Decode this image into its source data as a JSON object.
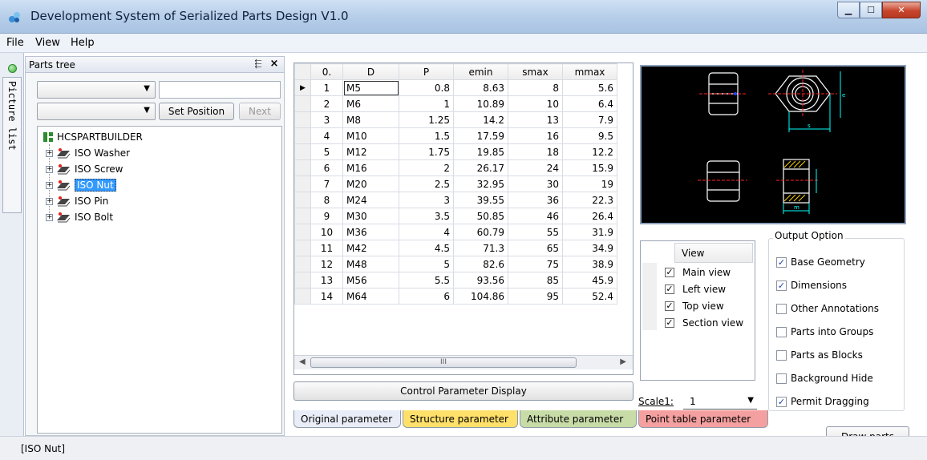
{
  "window": {
    "title": "Development System of Serialized Parts Design V1.0"
  },
  "menu": [
    "File",
    "View",
    "Help"
  ],
  "left_tab": {
    "label": "Picture list"
  },
  "tree_panel": {
    "title": "Parts tree",
    "pin_glyph": "⬱",
    "set_position_label": "Set Position",
    "next_label": "Next",
    "root_label": "HCSPARTBUILDER",
    "items": [
      "ISO Washer",
      "ISO Screw",
      "ISO Nut",
      "ISO Pin",
      "ISO Bolt"
    ],
    "selected_index": 2
  },
  "grid": {
    "columns": [
      "0.",
      "D",
      "P",
      "emin",
      "smax",
      "mmax"
    ],
    "rows": [
      [
        "1",
        "M5",
        "0.8",
        "8.63",
        "8",
        "5.6"
      ],
      [
        "2",
        "M6",
        "1",
        "10.89",
        "10",
        "6.4"
      ],
      [
        "3",
        "M8",
        "1.25",
        "14.2",
        "13",
        "7.9"
      ],
      [
        "4",
        "M10",
        "1.5",
        "17.59",
        "16",
        "9.5"
      ],
      [
        "5",
        "M12",
        "1.75",
        "19.85",
        "18",
        "12.2"
      ],
      [
        "6",
        "M16",
        "2",
        "26.17",
        "24",
        "15.9"
      ],
      [
        "7",
        "M20",
        "2.5",
        "32.95",
        "30",
        "19"
      ],
      [
        "8",
        "M24",
        "3",
        "39.55",
        "36",
        "22.3"
      ],
      [
        "9",
        "M30",
        "3.5",
        "50.85",
        "46",
        "26.4"
      ],
      [
        "10",
        "M36",
        "4",
        "60.79",
        "55",
        "31.9"
      ],
      [
        "11",
        "M42",
        "4.5",
        "71.3",
        "65",
        "34.9"
      ],
      [
        "12",
        "M48",
        "5",
        "82.6",
        "75",
        "38.9"
      ],
      [
        "13",
        "M56",
        "5.5",
        "93.56",
        "85",
        "45.9"
      ],
      [
        "14",
        "M64",
        "6",
        "104.86",
        "95",
        "52.4"
      ]
    ],
    "current_row_marker": "▶"
  },
  "control_button_label": "Control Parameter Display",
  "view_list": {
    "header": "View",
    "items": [
      {
        "label": "Main view",
        "checked": true
      },
      {
        "label": "Left view",
        "checked": true
      },
      {
        "label": "Top view",
        "checked": true
      },
      {
        "label": "Section view",
        "checked": true
      }
    ]
  },
  "output_option": {
    "title": "Output Option",
    "options": [
      {
        "label": "Base Geometry",
        "checked": true
      },
      {
        "label": "Dimensions",
        "checked": true
      },
      {
        "label": "Other Annotations",
        "checked": false
      },
      {
        "label": "Parts into Groups",
        "checked": false
      },
      {
        "label": "Parts as Blocks",
        "checked": false
      },
      {
        "label": "Background Hide",
        "checked": false
      },
      {
        "label": "Permit Dragging",
        "checked": true
      }
    ]
  },
  "scale": {
    "label": "Scale1:",
    "value": "1"
  },
  "param_tabs": [
    "Original parameter",
    "Structure parameter",
    "Attribute parameter",
    "Point table parameter"
  ],
  "draw_button_label": "Draw parts",
  "status": "[ISO Nut]",
  "preview": {
    "dim_label_e": "e",
    "dim_label_s": "s",
    "dim_label_m": "m"
  },
  "colors": {
    "preview_bg": "#000000",
    "line": "#ffffff",
    "dim": "#00ffff",
    "center": "#ff2020",
    "hatch": "#ffd200",
    "selection": "#3399ff"
  }
}
